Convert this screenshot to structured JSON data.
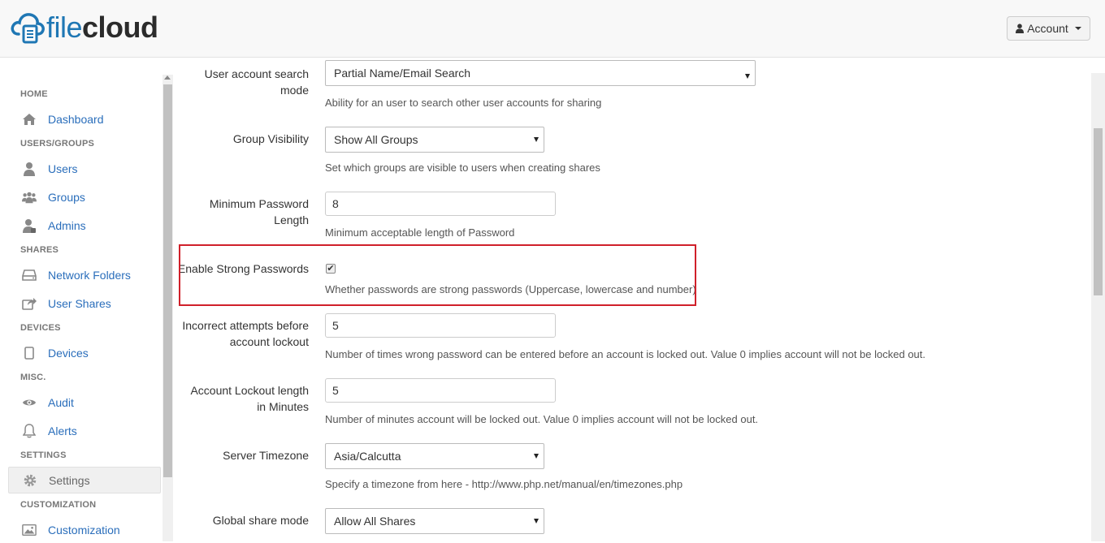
{
  "header": {
    "logo_file": "file",
    "logo_cloud": "cloud",
    "account_label": "Account",
    "brand_color": "#1f77b4"
  },
  "sidebar": {
    "sections": {
      "home": "HOME",
      "users_groups": "USERS/GROUPS",
      "shares": "SHARES",
      "devices": "DEVICES",
      "misc": "MISC.",
      "settings": "SETTINGS",
      "customization": "CUSTOMIZATION"
    },
    "items": {
      "dashboard": "Dashboard",
      "users": "Users",
      "groups": "Groups",
      "admins": "Admins",
      "network_folders": "Network Folders",
      "user_shares": "User Shares",
      "devices": "Devices",
      "audit": "Audit",
      "alerts": "Alerts",
      "settings": "Settings",
      "customization": "Customization"
    },
    "active_item": "settings"
  },
  "settings": {
    "user_search": {
      "label_line1": "User account search",
      "label_line2": "mode",
      "value": "Partial Name/Email Search",
      "help": "Ability for an user to search other user accounts for sharing"
    },
    "group_visibility": {
      "label": "Group Visibility",
      "value": "Show All Groups",
      "help": "Set which groups are visible to users when creating shares"
    },
    "min_password": {
      "label_line1": "Minimum Password",
      "label_line2": "Length",
      "value": "8",
      "help": "Minimum acceptable length of Password"
    },
    "strong_passwords": {
      "label": "Enable Strong Passwords",
      "checked": true,
      "help": "Whether passwords are strong passwords (Uppercase, lowercase and number)"
    },
    "incorrect_attempts": {
      "label_line1": "Incorrect attempts before",
      "label_line2": "account lockout",
      "value": "5",
      "help": "Number of times wrong password can be entered before an account is locked out. Value 0 implies account will not be locked out."
    },
    "lockout_length": {
      "label_line1": "Account Lockout length",
      "label_line2": "in Minutes",
      "value": "5",
      "help": "Number of minutes account will be locked out. Value 0 implies account will not be locked out."
    },
    "timezone": {
      "label": "Server Timezone",
      "value": "Asia/Calcutta",
      "help": "Specify a timezone from here - http://www.php.net/manual/en/timezones.php"
    },
    "share_mode": {
      "label": "Global share mode",
      "value": "Allow All Shares"
    }
  },
  "highlight_color": "#d0202a"
}
